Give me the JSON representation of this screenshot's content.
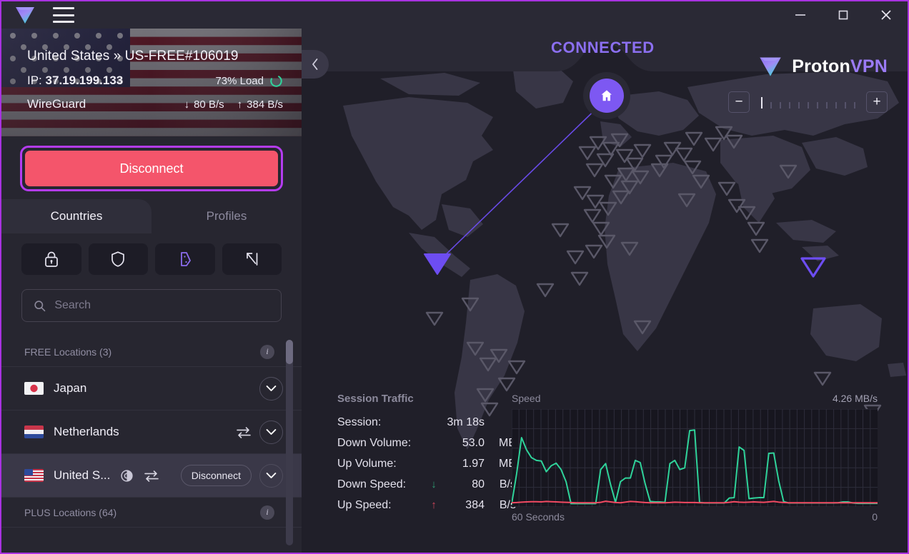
{
  "window": {
    "logo_icon": "proton-logo-icon",
    "menu_icon": "hamburger-menu-icon",
    "minimize_label": "–",
    "maximize_label": "□",
    "close_label": "✕"
  },
  "server_header": {
    "connection": "United States » US-FREE#106019",
    "ip_label": "IP:",
    "ip_value": "37.19.199.133",
    "load": "73% Load",
    "protocol": "WireGuard",
    "down_arrow": "↓",
    "down_speed": "80 B/s",
    "up_arrow": "↑",
    "up_speed": "384 B/s",
    "flag": "us-flag"
  },
  "disconnect_button": {
    "label": "Disconnect",
    "color": "#f4556b",
    "focus_ring": "#b43cf0"
  },
  "tabs": [
    {
      "label": "Countries",
      "active": true
    },
    {
      "label": "Profiles",
      "active": false
    }
  ],
  "toolbar_icons": [
    {
      "name": "secure-core-lock-icon",
      "active": false
    },
    {
      "name": "netshield-shield-icon",
      "active": false
    },
    {
      "name": "p2p-icon",
      "active": true
    },
    {
      "name": "tor-arrow-icon",
      "active": false
    }
  ],
  "search": {
    "placeholder": "Search",
    "value": "",
    "icon": "search-icon"
  },
  "server_list": {
    "groups": [
      {
        "title": "FREE Locations (3)",
        "info_icon": "info-icon"
      },
      {
        "title": "PLUS Locations (64)",
        "info_icon": "info-icon"
      }
    ],
    "rows": [
      {
        "country": "Japan",
        "flag": "jp-flag",
        "selected": false,
        "p2p": false,
        "tor": false,
        "action": null
      },
      {
        "country": "Netherlands",
        "flag": "nl-flag",
        "selected": false,
        "p2p": true,
        "tor": false,
        "action": null
      },
      {
        "country": "United S...",
        "flag": "us-flag",
        "selected": true,
        "p2p": true,
        "tor": true,
        "action": "Disconnect"
      }
    ]
  },
  "map": {
    "status": "CONNECTED",
    "status_color": "#8b6ff0",
    "home_icon": "home-icon",
    "collapse_icon": "chevron-left-icon",
    "connected_marker_color": "#6d4df2",
    "highlight_marker_color": "#6d4df2"
  },
  "brand": {
    "first": "Proton",
    "second": "VPN",
    "logo_icon": "proton-logo-icon"
  },
  "zoom_control": {
    "minus_label": "−",
    "plus_label": "+",
    "ticks": 11,
    "active_tick": 0,
    "minus_icon": "zoom-out-icon",
    "plus_icon": "zoom-in-icon"
  },
  "session_traffic": {
    "title": "Session Traffic",
    "rows": [
      {
        "label": "Session:",
        "arrow": "",
        "value": "3m 18s",
        "unit": ""
      },
      {
        "label": "Down Volume:",
        "arrow": "",
        "value": "53.0",
        "unit": "MB"
      },
      {
        "label": "Up Volume:",
        "arrow": "",
        "value": "1.97",
        "unit": "MB"
      },
      {
        "label": "Down Speed:",
        "arrow": "↓",
        "value": "80",
        "unit": "B/s"
      },
      {
        "label": "Up Speed:",
        "arrow": "↑",
        "value": "384",
        "unit": "B/s"
      }
    ]
  },
  "chart_data": {
    "type": "line",
    "title": "Speed",
    "max_label": "4.26",
    "max_unit": "MB/s",
    "xlabel_left": "60 Seconds",
    "xlabel_right": "0",
    "ylim": [
      0,
      4.26
    ],
    "xlim": [
      60,
      0
    ],
    "grid": true,
    "legend_position": "none",
    "series": [
      {
        "name": "Download",
        "color": "#2fd39a",
        "values": [
          0.0,
          1.42,
          3.12,
          2.55,
          2.18,
          2.05,
          2.02,
          1.52,
          1.8,
          1.92,
          1.62,
          1.05,
          0.02,
          0.02,
          0.02,
          0.02,
          0.02,
          0.02,
          1.62,
          1.9,
          0.92,
          0.08,
          1.05,
          1.22,
          1.22,
          2.05,
          1.95,
          0.95,
          0.12,
          0.1,
          0.1,
          0.08,
          1.9,
          2.05,
          1.62,
          1.7,
          3.45,
          3.48,
          0.08,
          0.05,
          0.05,
          0.05,
          0.05,
          0.05,
          0.28,
          0.3,
          2.68,
          2.52,
          0.25,
          0.28,
          0.3,
          0.3,
          2.38,
          2.4,
          1.1,
          0.12,
          0.05,
          0.05,
          0.05,
          0.05,
          0.05,
          0.05,
          0.05,
          0.05,
          0.05,
          0.05,
          0.06,
          0.1,
          0.1,
          0.05,
          0.03,
          0.03,
          0.03,
          0.03,
          0.03
        ]
      },
      {
        "name": "Upload",
        "color": "#f24a62",
        "values": [
          0.06,
          0.07,
          0.09,
          0.1,
          0.11,
          0.11,
          0.1,
          0.12,
          0.11,
          0.1,
          0.09,
          0.08,
          0.07,
          0.06,
          0.06,
          0.06,
          0.06,
          0.06,
          0.08,
          0.13,
          0.1,
          0.07,
          0.06,
          0.09,
          0.12,
          0.11,
          0.09,
          0.07,
          0.06,
          0.06,
          0.06,
          0.06,
          0.07,
          0.09,
          0.08,
          0.07,
          0.07,
          0.07,
          0.06,
          0.06,
          0.06,
          0.06,
          0.06,
          0.06,
          0.08,
          0.11,
          0.09,
          0.08,
          0.09,
          0.1,
          0.09,
          0.08,
          0.1,
          0.12,
          0.09,
          0.07,
          0.06,
          0.06,
          0.06,
          0.06,
          0.06,
          0.06,
          0.06,
          0.06,
          0.06,
          0.06,
          0.06,
          0.06,
          0.06,
          0.06,
          0.06,
          0.06,
          0.06,
          0.06,
          0.06
        ]
      }
    ]
  }
}
